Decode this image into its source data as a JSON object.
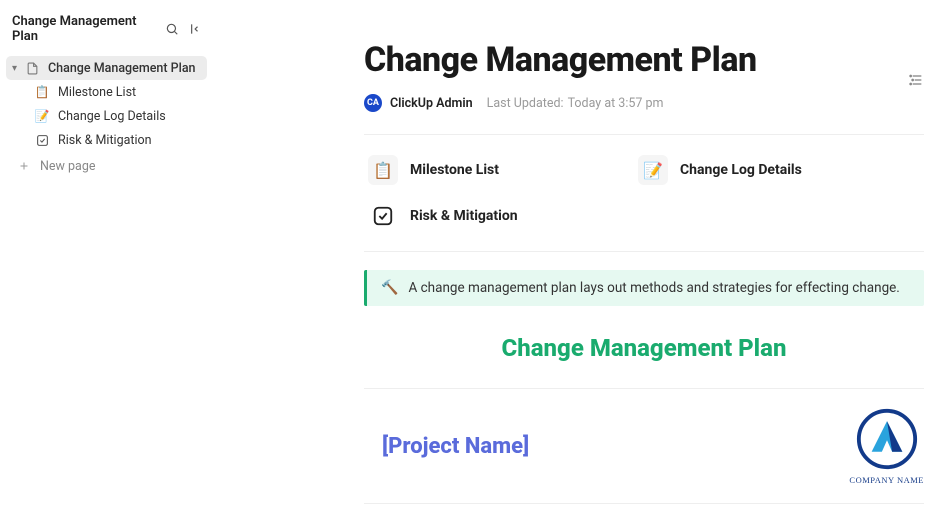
{
  "workspace": {
    "title": "Change Management Plan"
  },
  "nav": {
    "root": {
      "label": "Change Management Plan"
    },
    "items": [
      {
        "label": "Milestone List"
      },
      {
        "label": "Change Log Details"
      },
      {
        "label": "Risk & Mitigation"
      }
    ],
    "new_page": "New page"
  },
  "doc": {
    "title": "Change Management Plan",
    "author": "ClickUp Admin",
    "avatar_initials": "CA",
    "last_updated_label": "Last Updated:",
    "last_updated_value": "Today at 3:57 pm"
  },
  "cards": [
    {
      "label": "Milestone List"
    },
    {
      "label": "Change Log Details"
    },
    {
      "label": "Risk & Mitigation"
    }
  ],
  "callout": {
    "text": "A change management plan lays out methods and strategies for effecting change."
  },
  "section": {
    "heading": "Change Management Plan",
    "project_name": "[Project Name]",
    "company_name": "COMPANY NAME"
  }
}
